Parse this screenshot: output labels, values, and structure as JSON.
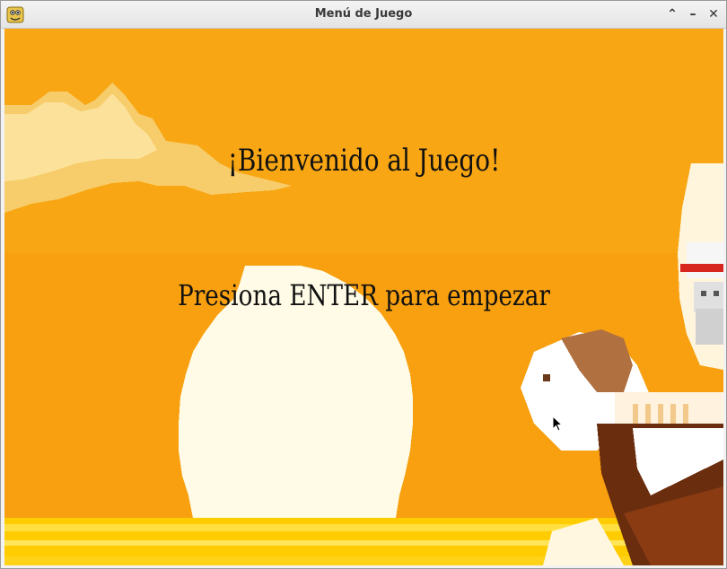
{
  "window": {
    "title": "Menú de Juego"
  },
  "controls": {
    "maximize": "⌃",
    "minimize": "–",
    "close": "✕"
  },
  "game": {
    "welcome_text": "¡Bienvenido al Juego!",
    "prompt_text": "Presiona ENTER para empezar"
  },
  "colors": {
    "sky": "#f8a512",
    "sun": "#fffbe6",
    "sea": "#ffd000",
    "text": "#111111"
  }
}
